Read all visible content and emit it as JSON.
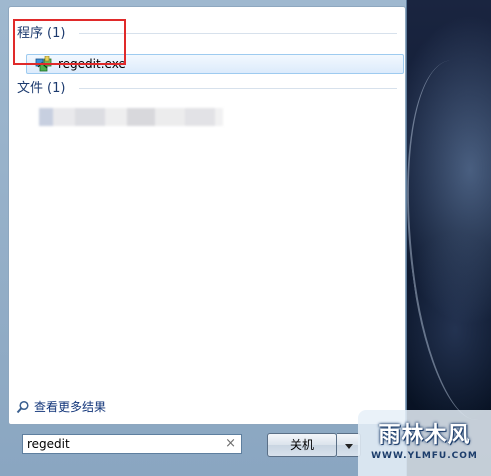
{
  "results": {
    "groups": [
      {
        "title": "程序",
        "count": "(1)",
        "items": [
          {
            "label": "regedit.exe",
            "icon": "regedit-icon"
          }
        ]
      },
      {
        "title": "文件",
        "count": "(1)"
      }
    ],
    "see_more": "查看更多结果"
  },
  "search": {
    "value": "regedit",
    "clear_icon": "×"
  },
  "shutdown": {
    "label": "关机"
  },
  "watermark": {
    "main": "雨林木风",
    "url": "WWW.YLMFU.COM"
  },
  "colors": {
    "highlight": "#e02a2a",
    "group_header": "#1c3a6e",
    "link": "#12357a"
  }
}
